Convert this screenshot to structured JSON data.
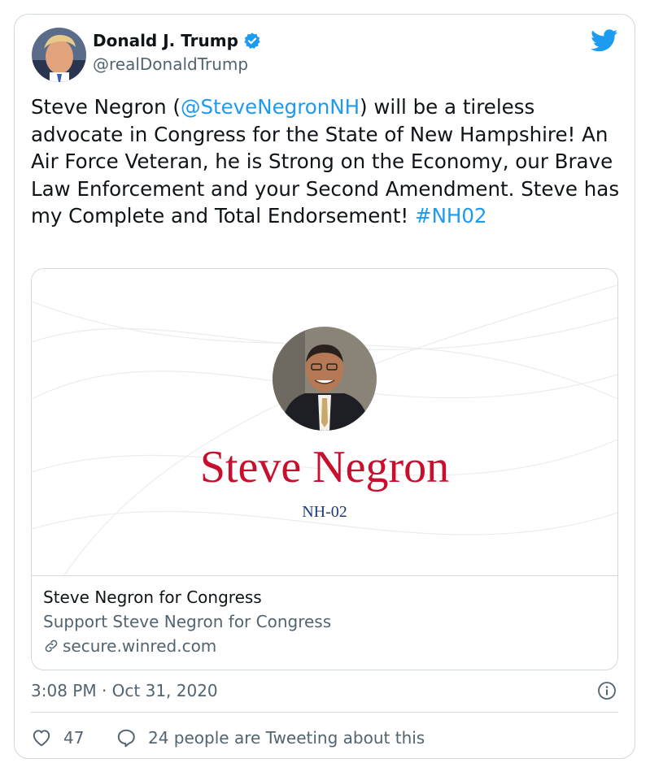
{
  "author": {
    "name": "Donald J. Trump",
    "handle": "@realDonaldTrump",
    "verified": true
  },
  "tweet": {
    "text_before": "Steve Negron (",
    "mention": "@SteveNegronNH",
    "text_middle": ") will be a tireless advocate in Congress for the State of New Hampshire! An Air Force Veteran, he is Strong on the Economy, our Brave Law Enforcement and your Second Amendment. Steve has my Complete and Total Endorsement! ",
    "hashtag": "#NH02"
  },
  "preview": {
    "image_name": "Steve Negron",
    "image_subtitle": "NH-02",
    "title": "Steve Negron for Congress",
    "description": "Support Steve Negron for Congress",
    "domain": "secure.winred.com"
  },
  "meta": {
    "timestamp": "3:08 PM · Oct 31, 2020",
    "likes": "47",
    "conversation": "24 people are Tweeting about this"
  },
  "colors": {
    "accent": "#1d9bf0",
    "muted": "#536471",
    "border": "#cfd9de",
    "candidate_red": "#c8102e",
    "candidate_blue": "#1f3a7a"
  },
  "icons": {
    "brand": "twitter-bird-icon",
    "verified": "verified-badge-icon",
    "link": "link-icon",
    "info": "info-icon",
    "like": "heart-icon",
    "reply": "speech-bubble-icon"
  }
}
